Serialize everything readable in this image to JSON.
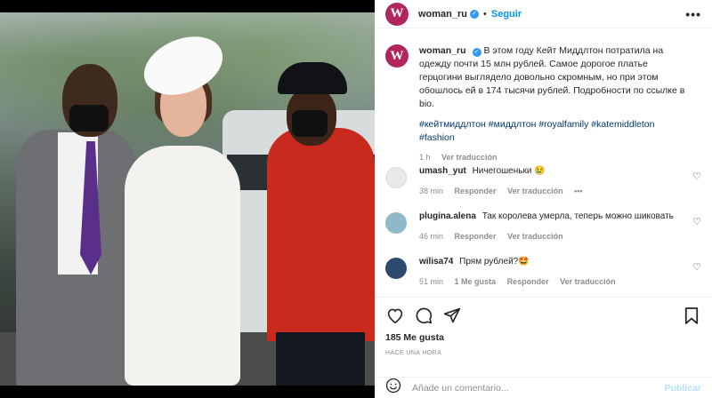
{
  "post": {
    "username": "woman_ru",
    "follow_label": "Seguir",
    "more_label": "•••",
    "avatar_letter": "W",
    "brand_color": "#b0275d"
  },
  "caption": {
    "username": "woman_ru",
    "text": "В этом году Кейт Миддлтон потратила на одежду почти 15 млн рублей. Самое дорогое платье герцогини выглядело довольно скромным, но при этом обошлось ей в 174 тысячи рублей. Подробности по ссылке в bio.",
    "hashtags": "#кейтмиддлтон #миддлтон #royalfamily #katemiddleton #fashion",
    "time": "1 h",
    "translation_label": "Ver traducción"
  },
  "comments": [
    {
      "username": "umash_yut",
      "text": "Ничегошеньки 😢",
      "time": "38 min",
      "reply_label": "Responder",
      "translation_label": "Ver traducción",
      "extra": "•••",
      "likes": "",
      "avatar_color": "#e9e9e9"
    },
    {
      "username": "plugina.alena",
      "text": "Так королева умерла, теперь можно шиковать",
      "time": "46 min",
      "reply_label": "Responder",
      "translation_label": "Ver traducción",
      "extra": "",
      "likes": "",
      "avatar_color": "#8fb8c9"
    },
    {
      "username": "wilisa74",
      "text": "Прям рублей?🤩",
      "time": "51 min",
      "likes": "1 Me gusta",
      "reply_label": "Responder",
      "translation_label": "Ver traducción",
      "extra": "",
      "avatar_color": "#2d4a6e"
    }
  ],
  "stats": {
    "likes": "185 Me gusta",
    "time_ago": "HACE UNA HORA"
  },
  "composer": {
    "placeholder": "Añade un comentario...",
    "publish_label": "Publicar"
  },
  "icons": {
    "like": "heart-icon",
    "comment": "comment-icon",
    "share": "share-icon",
    "save": "bookmark-icon",
    "emoji": "emoji-icon"
  }
}
